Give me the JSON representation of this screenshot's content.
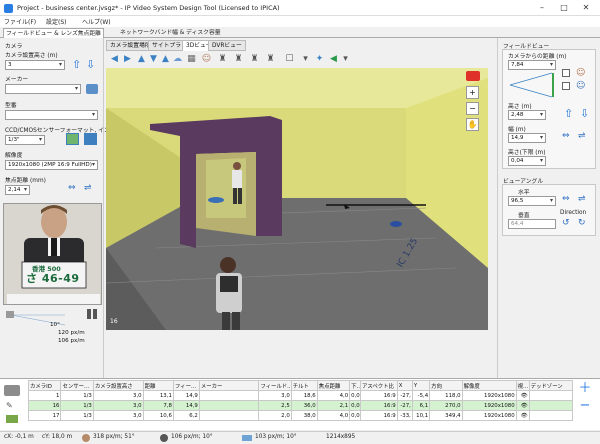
{
  "window": {
    "title": "Project - business center.jvsgz* - IP Video System Design Tool (Licensed to IPICA)"
  },
  "menu": [
    "ファイル(F)",
    "設定(S)",
    "ヘルプ(W)"
  ],
  "main_tabs": [
    "フィールドビュー & レンズ焦点距離",
    "ネットワークバンド幅 & ディスク容量"
  ],
  "left": {
    "camera_header": "カメラ",
    "height_label": "カメラ設置高さ (m)",
    "height_value": "3",
    "maker_label": "メーカー",
    "maker_value": "",
    "model_label": "型番",
    "model_value": "",
    "sensor_label": "CCD/CMOSセンサーフォーマット, インチ",
    "sensor_value": "1/3\"",
    "res_label": "解像度",
    "res_value": "1920x1080 (2MP 16:9 FullHD)",
    "focal_label": "焦点距離 (mm)",
    "focal_value": "2,14",
    "plate_line1": "香港 500",
    "plate_line2": "さ 46-49",
    "diagram_angle": "10°",
    "diagram_density1": "120 px/m",
    "diagram_density2": "106 px/m"
  },
  "view_tabs": [
    "カメラ設置場所",
    "サイトプラン",
    "3Dビュー",
    "DVRビュー"
  ],
  "scene": {
    "camera_number": "16",
    "floor_text": "IC 1.25"
  },
  "right": {
    "fov_header": "フィールドビュー",
    "distance_label": "カメラからの距離 (m)",
    "distance_value": "7,84",
    "height_label": "高さ (m)",
    "height_value": "2,48",
    "width_label": "幅 (m)",
    "width_value": "14,9",
    "lower_label": "高さ(下限 (m)",
    "lower_value": "0,04",
    "angle_header": "ビューアングル",
    "horizontal_label": "水平",
    "horizontal_value": "96,5",
    "vertical_label": "垂直",
    "vertical_value": "64,4",
    "direction_label": "Direction"
  },
  "table": {
    "headers": [
      "カメラID",
      "センサー...",
      "カメラ設置高さ",
      "距離",
      "フィー...",
      "メーカー",
      "フィールド...",
      "チルト",
      "焦点距離",
      "下...",
      "アスペクト比",
      "X",
      "Y",
      "方向",
      "解像度",
      "視...",
      "デッドゾーン"
    ],
    "rows": [
      [
        "1",
        "1/3",
        "3,0",
        "13,1",
        "14,9",
        "",
        "3,0",
        "18,6",
        "4,0",
        "0,0",
        "16:9",
        "-27,",
        "-5,4",
        "118,0",
        "1920x1080",
        "👁",
        ""
      ],
      [
        "16",
        "1/3",
        "3,0",
        "7,8",
        "14,9",
        "",
        "2,5",
        "36,0",
        "2,1",
        "0,0",
        "16:9",
        "-27,",
        "6,1",
        "270,0",
        "1920x1080",
        "👁",
        ""
      ],
      [
        "17",
        "1/3",
        "3,0",
        "10,6",
        "6,2",
        "",
        "2,0",
        "38,0",
        "4,0",
        "0,0",
        "16:9",
        "-33,",
        "10,1",
        "349,4",
        "1920x1080",
        "👁",
        ""
      ]
    ]
  },
  "status": {
    "x": "cX: -0,1 m",
    "y": "cY: 18,0 m",
    "d1": "318 px/m; 51°",
    "d2": "106 px/m; 10°",
    "d3": "103 px/m; 10°",
    "res": "1214x895"
  },
  "colors": {
    "accent": "#1e73d6",
    "wall": "#e4e47a",
    "frame": "#5c3a5c",
    "floor": "#6e6e6e",
    "highlight_row": "#d4f2d0"
  }
}
